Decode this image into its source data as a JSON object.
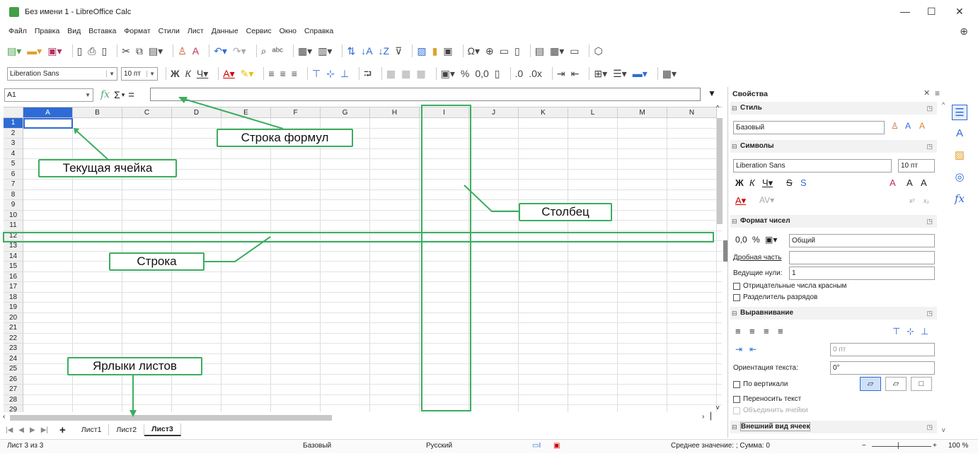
{
  "window": {
    "title": "Без имени 1 - LibreOffice Calc",
    "minimize": "—",
    "maximize": "☐",
    "close": "✕"
  },
  "menu": [
    "Файл",
    "Правка",
    "Вид",
    "Вставка",
    "Формат",
    "Стили",
    "Лист",
    "Данные",
    "Сервис",
    "Окно",
    "Справка"
  ],
  "format_bar": {
    "font_name": "Liberation Sans",
    "font_size": "10 пт"
  },
  "formula_bar": {
    "name_box": "A1",
    "fx": "fx",
    "sigma": "Σ",
    "equals": "="
  },
  "columns": [
    "A",
    "B",
    "C",
    "D",
    "E",
    "F",
    "G",
    "H",
    "I",
    "J",
    "K",
    "L",
    "M",
    "N"
  ],
  "rows": [
    "1",
    "2",
    "3",
    "4",
    "5",
    "6",
    "7",
    "8",
    "9",
    "10",
    "11",
    "12",
    "13",
    "14",
    "15",
    "16",
    "17",
    "18",
    "19",
    "20",
    "21",
    "22",
    "23",
    "24",
    "25",
    "26",
    "27",
    "28",
    "29"
  ],
  "sheet_tabs": [
    "Лист1",
    "Лист2",
    "Лист3"
  ],
  "active_tab": "Лист3",
  "status": {
    "sheet": "Лист 3 из 3",
    "style": "Базовый",
    "language": "Русский",
    "summary": "Среднее значение: ; Сумма: 0",
    "zoom": "100 %"
  },
  "sidebar": {
    "title": "Свойства",
    "style_section": "Стиль",
    "style_value": "Базовый",
    "chars_section": "Символы",
    "font": "Liberation Sans",
    "size": "10 пт",
    "numfmt_section": "Формат чисел",
    "numfmt_value": "Общий",
    "decimals_label": "Дробная часть",
    "decimals_value": "",
    "leading_zeros_label": "Ведущие нули:",
    "leading_zeros_value": "1",
    "neg_red": "Отрицательные числа красным",
    "thousands": "Разделитель разрядов",
    "align_section": "Выравнивание",
    "indent_value": "0 пт",
    "orientation_label": "Ориентация текста:",
    "orientation_value": "0°",
    "vertical": "По вертикали",
    "wrap": "Переносить текст",
    "merge": "Объединить ячейки",
    "cell_appearance": "Внешний вид ячеек"
  },
  "callouts": {
    "formula_bar": "Строка формул",
    "current_cell": "Текущая ячейка",
    "column": "Столбец",
    "row": "Строка",
    "sheet_tabs": "Ярлыки листов"
  },
  "colors": {
    "accent": "#2f6bd5",
    "annotation": "#3aae5e"
  }
}
